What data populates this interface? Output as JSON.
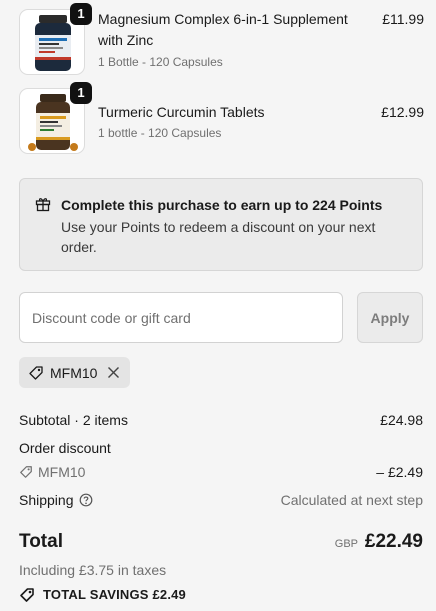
{
  "cart": {
    "items": [
      {
        "name": "Magnesium Complex 6-in-1 Supplement with Zinc",
        "variant": "1 Bottle - 120 Capsules",
        "price": "£11.99",
        "quantity": "1",
        "image": "magnesium-bottle-image"
      },
      {
        "name": "Turmeric Curcumin Tablets",
        "variant": "1 bottle - 120 Capsules",
        "price": "£12.99",
        "quantity": "1",
        "image": "turmeric-bottle-image"
      }
    ]
  },
  "points_banner": {
    "icon": "gift-icon",
    "title": "Complete this purchase to earn up to 224 Points",
    "body": "Use your Points to redeem a discount on your next order."
  },
  "discount": {
    "placeholder": "Discount code or gift card",
    "value": "",
    "apply_label": "Apply",
    "applied_code": "MFM10"
  },
  "summary": {
    "subtotal_label": "Subtotal · 2 items",
    "subtotal_value": "£24.98",
    "order_discount_label": "Order discount",
    "discount_code": "MFM10",
    "discount_value": "– £2.49",
    "shipping_label": "Shipping",
    "shipping_value": "Calculated at next step",
    "total_label": "Total",
    "currency": "GBP",
    "total_value": "£22.49",
    "taxes": "Including £3.75 in taxes",
    "savings": "TOTAL SAVINGS  £2.49"
  },
  "colors": {
    "background": "#f5f5f5",
    "text": "#1a1a1a",
    "muted": "#707070",
    "badge": "#111111"
  }
}
